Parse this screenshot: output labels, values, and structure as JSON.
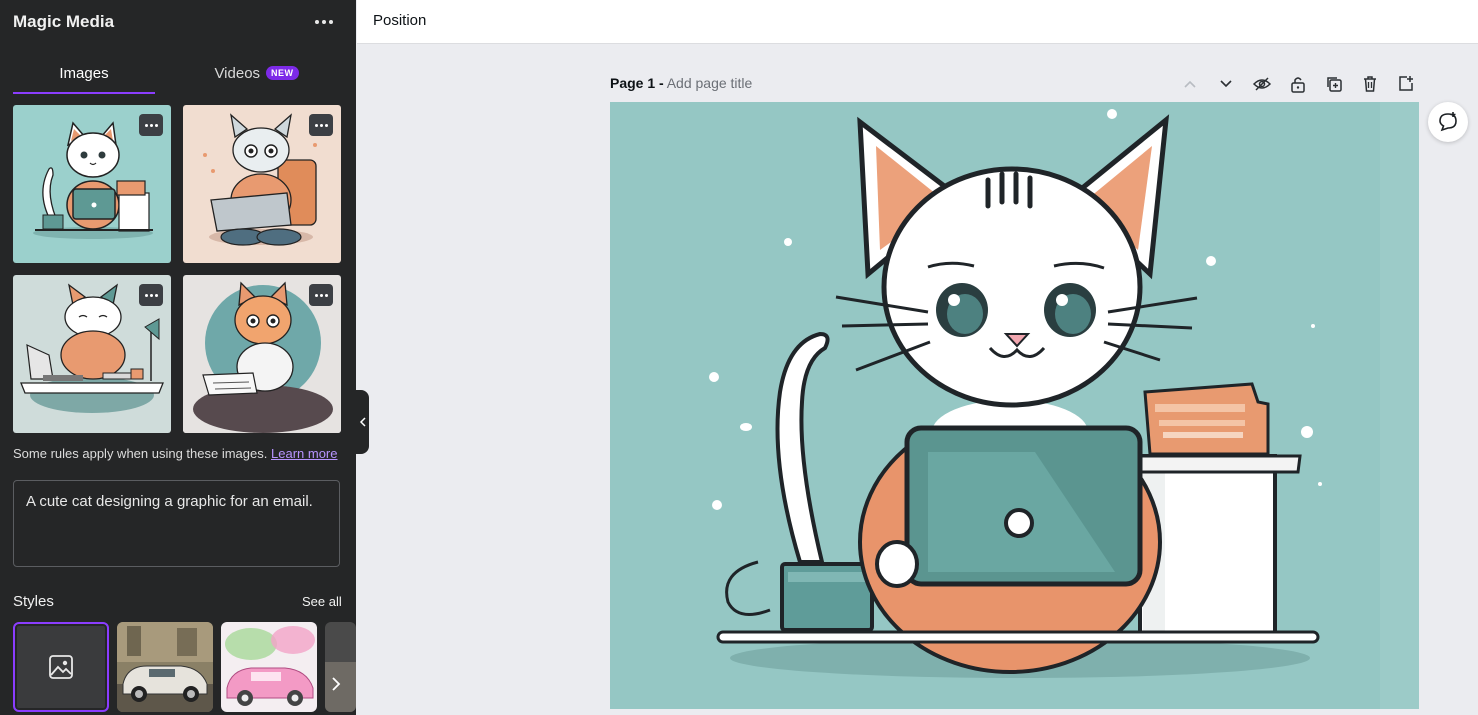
{
  "panel": {
    "title": "Magic Media",
    "tabs": [
      {
        "label": "Images"
      },
      {
        "label": "Videos",
        "badge": "NEW"
      }
    ],
    "rules_text": "Some rules apply when using these images.",
    "learn_more": "Learn more",
    "prompt_value": "A cute cat designing a graphic for an email.",
    "styles_label": "Styles",
    "see_all": "See all"
  },
  "topbar": {
    "position_label": "Position"
  },
  "page": {
    "label": "Page 1 -",
    "title_placeholder": "Add page title"
  },
  "colors": {
    "accent": "#8b3dff",
    "panel_bg": "#252627",
    "canvas_bg": "#ebecf0",
    "art_teal": "#95c7c4",
    "art_orange": "#e89a70"
  }
}
